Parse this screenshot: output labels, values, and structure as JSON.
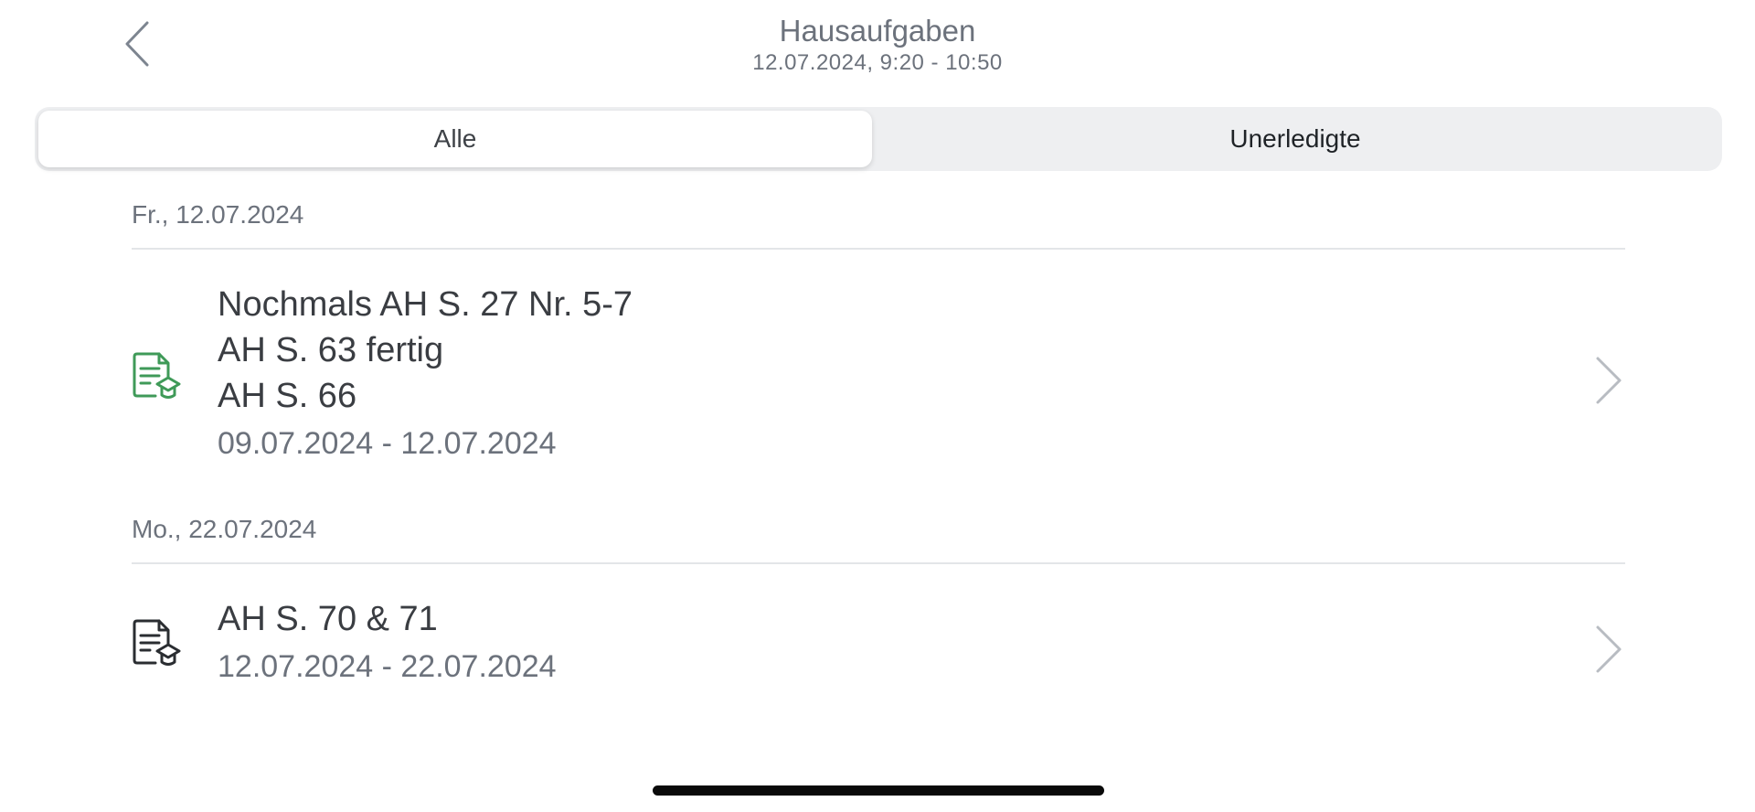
{
  "header": {
    "title": "Hausaufgaben",
    "subtitle": "12.07.2024, 9:20 - 10:50",
    "back_icon": "chevron-left-icon"
  },
  "segments": {
    "all_label": "Alle",
    "open_label": "Unerledigte",
    "selected": "Alle"
  },
  "sections": [
    {
      "date": "Fr., 12.07.2024",
      "items": [
        {
          "icon": "homework-document-icon",
          "icon_color": "#3f9a58",
          "lines": [
            "Nochmals AH S. 27 Nr. 5-7",
            "AH S. 63 fertig",
            "AH S. 66"
          ],
          "range": "09.07.2024 - 12.07.2024"
        }
      ]
    },
    {
      "date": "Mo., 22.07.2024",
      "items": [
        {
          "icon": "homework-document-icon",
          "icon_color": "#2a2d31",
          "lines": [
            "AH S. 70 & 71"
          ],
          "range": "12.07.2024 - 22.07.2024"
        }
      ]
    }
  ],
  "colors": {
    "accent_green": "#3f9a58",
    "muted_text": "#6c727c",
    "segment_bg": "#eeeff1"
  }
}
